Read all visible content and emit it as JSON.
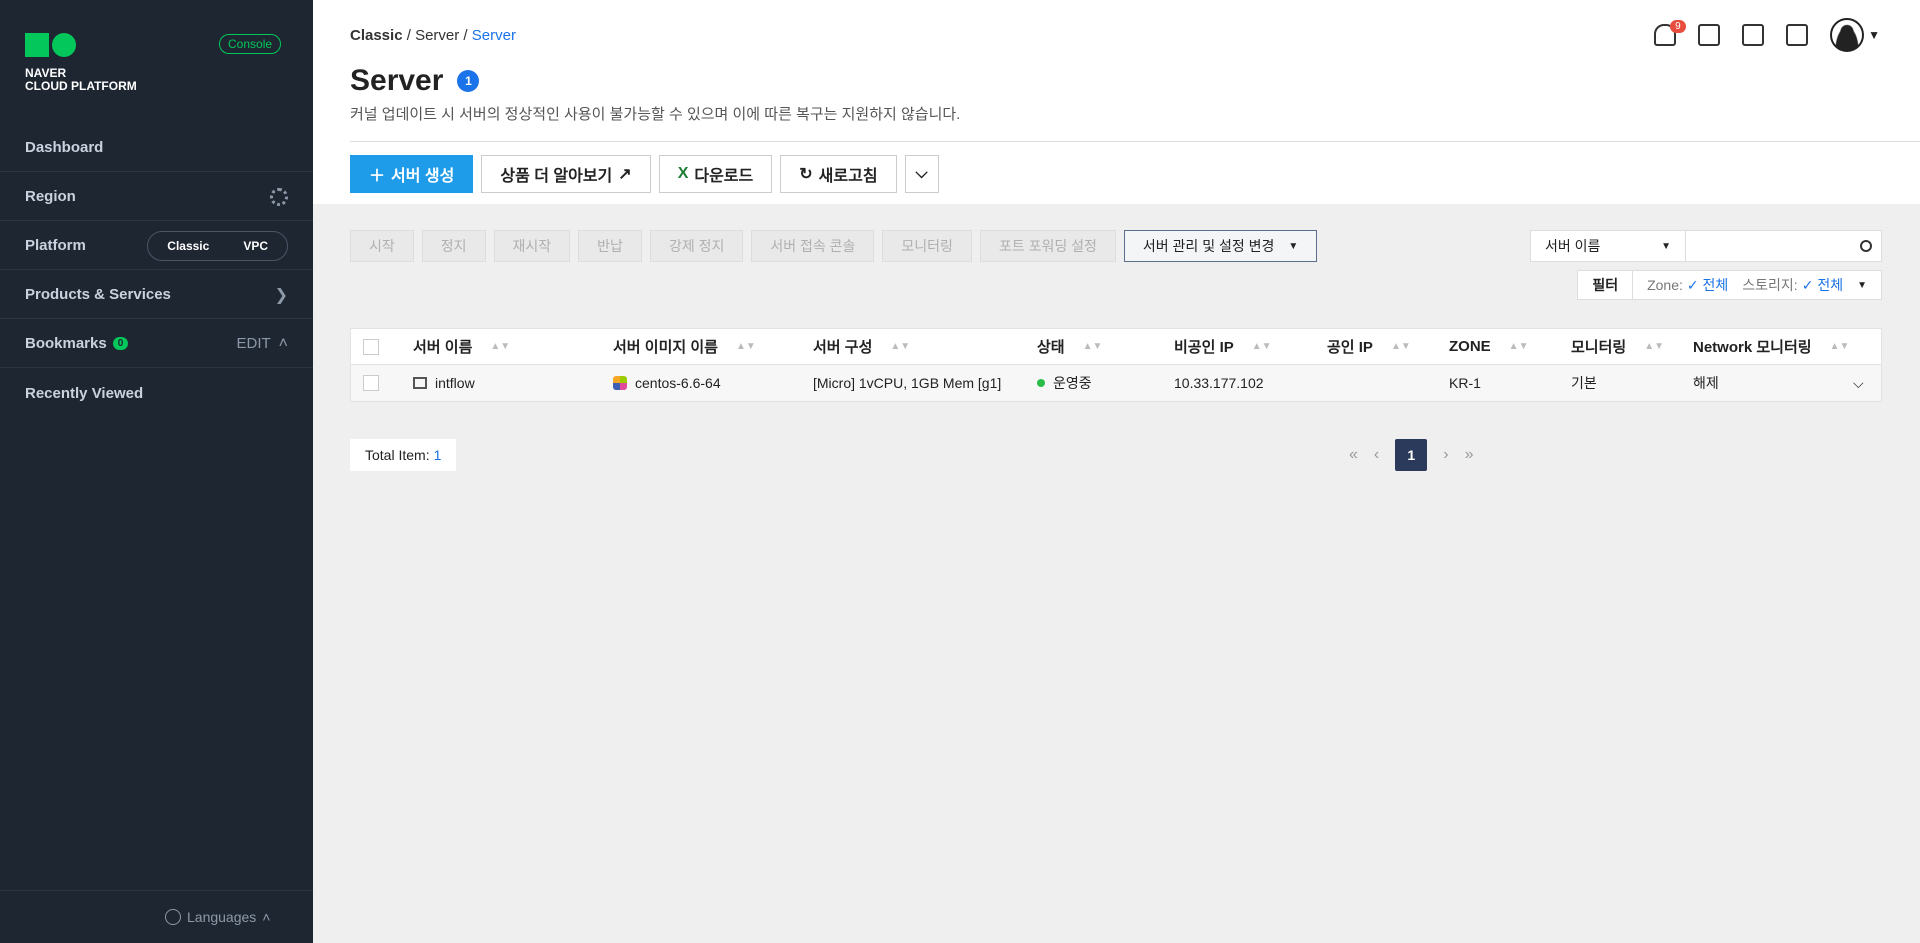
{
  "sidebar": {
    "logo_line1": "NAVER",
    "logo_line2": "CLOUD PLATFORM",
    "console_label": "Console",
    "dashboard": "Dashboard",
    "region": "Region",
    "platform": "Platform",
    "platform_options": [
      "Classic",
      "VPC"
    ],
    "products": "Products & Services",
    "bookmarks": "Bookmarks",
    "bookmarks_count": "0",
    "bookmarks_edit": "EDIT",
    "recently_viewed": "Recently Viewed",
    "languages": "Languages"
  },
  "breadcrumb": [
    "Classic",
    "Server",
    "Server"
  ],
  "topbar": {
    "notification_count": "9"
  },
  "page": {
    "title": "Server",
    "title_count": "1",
    "subtitle": "커널 업데이트 시 서버의 정상적인 사용이 불가능할 수 있으며 이에 따른 복구는 지원하지 않습니다."
  },
  "actions": {
    "create": "서버 생성",
    "learn_more": "상품 더 알아보기",
    "download": "다운로드",
    "refresh": "새로고침"
  },
  "toolbar": {
    "buttons": [
      "시작",
      "정지",
      "재시작",
      "반납",
      "강제 정지",
      "서버 접속 콘솔",
      "모니터링",
      "포트 포워딩 설정"
    ],
    "manage": "서버 관리 및 설정 변경"
  },
  "search": {
    "field": "서버 이름",
    "placeholder": ""
  },
  "filter": {
    "label": "필터",
    "zone_label": "Zone:",
    "zone_value": "전체",
    "storage_label": "스토리지:",
    "storage_value": "전체"
  },
  "table": {
    "headers": [
      "서버 이름",
      "서버 이미지 이름",
      "서버 구성",
      "상태",
      "비공인 IP",
      "공인 IP",
      "ZONE",
      "모니터링",
      "Network 모니터링"
    ],
    "rows": [
      {
        "name": "intflow",
        "image": "centos-6.6-64",
        "spec": "[Micro] 1vCPU, 1GB Mem [g1]",
        "status": "운영중",
        "private_ip": "10.33.177.102",
        "public_ip": "",
        "zone": "KR-1",
        "monitoring": "기본",
        "network_monitoring": "해제"
      }
    ]
  },
  "pagination": {
    "total_label": "Total Item:",
    "total": "1",
    "current_page": "1"
  },
  "colors": {
    "primary": "#1e9be9",
    "sidebar_bg": "#1e2632",
    "accent_green": "#03c75a",
    "status_running": "#2bbd47"
  }
}
